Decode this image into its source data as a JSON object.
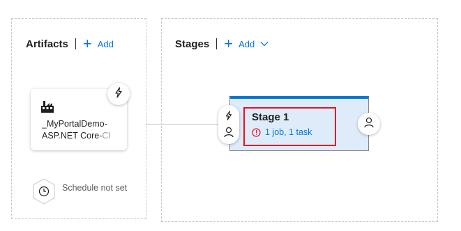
{
  "artifacts": {
    "title": "Artifacts",
    "add_label": "Add",
    "card": {
      "name_line1": "_MyPortalDemo-",
      "name_line2_main": "ASP.NET Core-",
      "name_line2_faded": "CI"
    },
    "schedule_label": "Schedule not set"
  },
  "stages": {
    "title": "Stages",
    "add_label": "Add",
    "stage": {
      "name": "Stage 1",
      "status": "1 job, 1 task"
    }
  },
  "colors": {
    "accent": "#0078d4",
    "stage_fill": "#deecf9",
    "highlight": "#e81123",
    "warning": "#e81123"
  },
  "icons": [
    "plus-icon",
    "chevron-down-icon",
    "build-icon",
    "lightning-icon",
    "clock-icon",
    "person-icon",
    "warning-circle-icon"
  ]
}
